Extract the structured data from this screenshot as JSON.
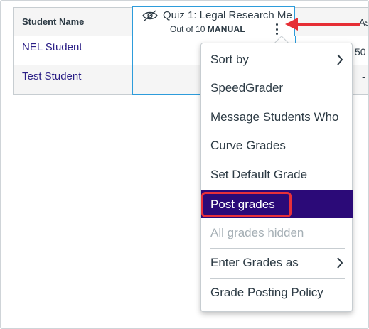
{
  "gradebook": {
    "columns": {
      "student_name": "Student Name",
      "quiz_title": "Quiz 1: Legal Research Me",
      "quiz_points": "Out of 10",
      "quiz_grading_mode": "MANUAL",
      "next_column_partial": "Assign"
    },
    "rows": [
      {
        "student": "NEL Student",
        "next_column_value": "50"
      },
      {
        "student": "Test Student",
        "next_column_value": "-"
      }
    ]
  },
  "column_menu": {
    "items": [
      {
        "label": "Sort by",
        "submenu": true,
        "state": "normal"
      },
      {
        "label": "SpeedGrader",
        "submenu": false,
        "state": "normal"
      },
      {
        "label": "Message Students Who",
        "submenu": false,
        "state": "normal"
      },
      {
        "label": "Curve Grades",
        "submenu": false,
        "state": "normal"
      },
      {
        "label": "Set Default Grade",
        "submenu": false,
        "state": "normal"
      },
      {
        "label": "Post grades",
        "submenu": false,
        "state": "active"
      },
      {
        "label": "All grades hidden",
        "submenu": false,
        "state": "disabled"
      },
      {
        "label": "Enter Grades as",
        "submenu": true,
        "state": "normal"
      },
      {
        "label": "Grade Posting Policy",
        "submenu": false,
        "state": "normal"
      }
    ]
  },
  "colors": {
    "active_item": "#2b0a78",
    "link": "#2b1f86",
    "annotation_red": "#e62e35",
    "column_focus": "#2d9cdb"
  },
  "icons": {
    "hidden": "eye-slash-icon",
    "options": "kebab-menu-icon",
    "submenu": "chevron-right-icon"
  }
}
